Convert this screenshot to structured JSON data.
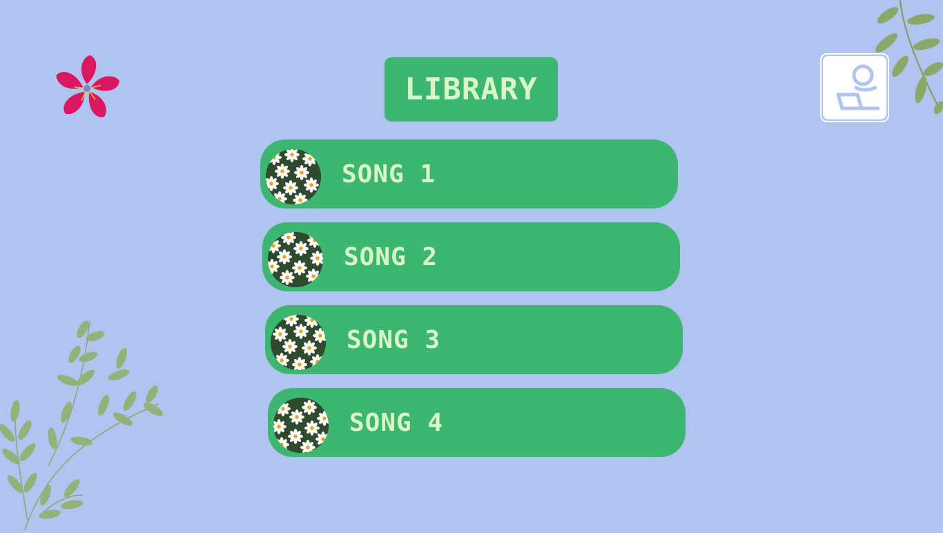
{
  "header": {
    "title": "LIBRARY"
  },
  "user_button": {
    "icon": "user-laptop-icon"
  },
  "songs": [
    {
      "label": "SONG 1",
      "thumbnail": "daisy-thumbnail"
    },
    {
      "label": "SONG 2",
      "thumbnail": "daisy-thumbnail"
    },
    {
      "label": "SONG 3",
      "thumbnail": "daisy-thumbnail"
    },
    {
      "label": "SONG 4",
      "thumbnail": "daisy-thumbnail"
    }
  ],
  "decorations": [
    "pink-flower-icon",
    "leaf-branch-top-right",
    "leaf-branch-bottom-left"
  ],
  "colors": {
    "background": "#b1c3ef",
    "accent": "#3db672",
    "text": "#d9f7c5",
    "flower": "#d9185f",
    "leaf": "#8aa86a"
  }
}
